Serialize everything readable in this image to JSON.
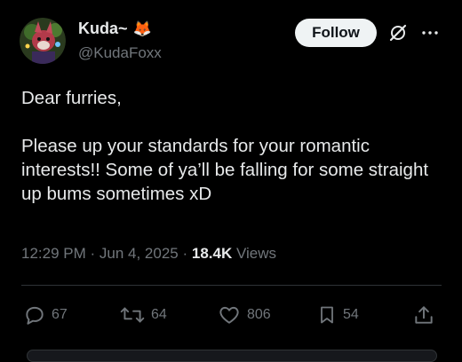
{
  "author": {
    "display_name": "Kuda~",
    "handle": "@KudaFoxx",
    "emoji": "🦊"
  },
  "follow_label": "Follow",
  "tweet": {
    "text": "Dear furries,\n\nPlease up your standards for your romantic interests!! Some of ya’ll be falling for some straight up bums sometimes xD"
  },
  "meta": {
    "time": "12:29 PM",
    "date": "Jun 4, 2025",
    "views_count": "18.4K",
    "views_label": "Views"
  },
  "actions": {
    "replies": "67",
    "reposts": "64",
    "likes": "806",
    "bookmarks": "54"
  },
  "colors": {
    "background": "#000000",
    "text": "#e7e9ea",
    "secondary": "#71767b",
    "divider": "#2f3336"
  }
}
